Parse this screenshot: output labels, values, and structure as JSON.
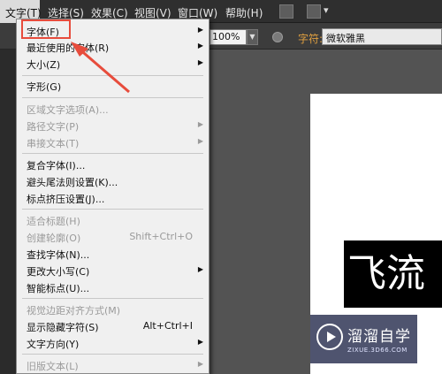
{
  "menubar": {
    "items": [
      "文字(T)",
      "选择(S)",
      "效果(C)",
      "视图(V)",
      "窗口(W)",
      "帮助(H)"
    ]
  },
  "controlbar": {
    "zoom": "100%",
    "char_label": "字符:",
    "font_name": "微软雅黑"
  },
  "menu": {
    "items": [
      {
        "label": "字体(F)",
        "shortcut": "",
        "submenu": true,
        "disabled": false
      },
      {
        "label": "最近使用的字体(R)",
        "shortcut": "",
        "submenu": true,
        "disabled": false
      },
      {
        "label": "大小(Z)",
        "shortcut": "",
        "submenu": true,
        "disabled": false
      },
      {
        "label": "字形(G)",
        "shortcut": "",
        "submenu": false,
        "disabled": false
      },
      {
        "label": "区域文字选项(A)...",
        "shortcut": "",
        "submenu": false,
        "disabled": true
      },
      {
        "label": "路径文字(P)",
        "shortcut": "",
        "submenu": true,
        "disabled": true
      },
      {
        "label": "串接文本(T)",
        "shortcut": "",
        "submenu": true,
        "disabled": true
      },
      {
        "label": "复合字体(I)...",
        "shortcut": "",
        "submenu": false,
        "disabled": false
      },
      {
        "label": "避头尾法则设置(K)...",
        "shortcut": "",
        "submenu": false,
        "disabled": false
      },
      {
        "label": "标点挤压设置(J)...",
        "shortcut": "",
        "submenu": false,
        "disabled": false
      },
      {
        "label": "适合标题(H)",
        "shortcut": "",
        "submenu": false,
        "disabled": true
      },
      {
        "label": "创建轮廓(O)",
        "shortcut": "Shift+Ctrl+O",
        "submenu": false,
        "disabled": true
      },
      {
        "label": "查找字体(N)...",
        "shortcut": "",
        "submenu": false,
        "disabled": false
      },
      {
        "label": "更改大小写(C)",
        "shortcut": "",
        "submenu": true,
        "disabled": false
      },
      {
        "label": "智能标点(U)...",
        "shortcut": "",
        "submenu": false,
        "disabled": false
      },
      {
        "label": "视觉边距对齐方式(M)",
        "shortcut": "",
        "submenu": false,
        "disabled": true
      },
      {
        "label": "显示隐藏字符(S)",
        "shortcut": "Alt+Ctrl+I",
        "submenu": false,
        "disabled": false
      },
      {
        "label": "文字方向(Y)",
        "shortcut": "",
        "submenu": true,
        "disabled": false
      },
      {
        "label": "旧版文本(L)",
        "shortcut": "",
        "submenu": true,
        "disabled": true
      }
    ]
  },
  "canvas": {
    "text": "飞流"
  },
  "watermark": {
    "title": "溜溜自学",
    "url": "ZIXUE.3D66.COM"
  },
  "colors": {
    "annotation": "#e74c3c",
    "char_label": "#e0a040"
  }
}
